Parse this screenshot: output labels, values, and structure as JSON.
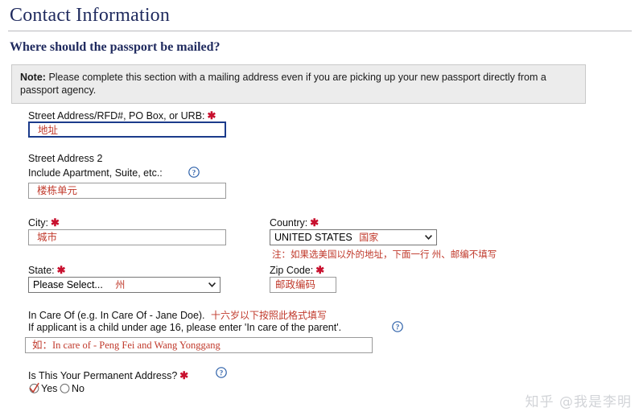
{
  "header": {
    "title": "Contact Information",
    "question": "Where should the passport be mailed?"
  },
  "note": {
    "label": "Note:",
    "text": "Please complete this section with a mailing address even if you are picking up your new passport directly from a passport agency."
  },
  "fields": {
    "street1": {
      "label": "Street Address/RFD#, PO Box, or URB:",
      "required_mark": "✱",
      "value": "地址"
    },
    "street2": {
      "label_line1": "Street Address 2",
      "label_line2": "Include Apartment, Suite, etc.:",
      "help_icon": "help-question-icon",
      "value": "楼栋单元"
    },
    "city": {
      "label": "City:",
      "required_mark": "✱",
      "value": "城市"
    },
    "country": {
      "label": "Country:",
      "required_mark": "✱",
      "value": "UNITED STATES",
      "annotation": "国家",
      "note": "注：如果选美国以外的地址，下面一行 州、邮编不填写",
      "chevron_icon": "chevron-down-icon"
    },
    "state": {
      "label": "State:",
      "required_mark": "✱",
      "value": "Please Select...",
      "annotation": "州",
      "chevron_icon": "chevron-down-icon"
    },
    "zip": {
      "label": "Zip Code:",
      "required_mark": "✱",
      "value": "邮政编码"
    },
    "in_care_of": {
      "label_line1": "In Care Of (e.g. In Care Of - Jane Doe).",
      "annotation": "十六岁以下按照此格式填写",
      "label_line2": "If applicant is a child under age 16, please enter 'In care of the parent'.",
      "help_icon": "help-question-icon",
      "value": "如：In care of - Peng Fei and Wang Yonggang"
    },
    "permanent_address": {
      "label": "Is This Your Permanent Address?",
      "required_mark": "✱",
      "help_icon": "help-question-icon",
      "yes_label": "Yes",
      "no_label": "No",
      "selected": "Yes"
    }
  },
  "watermark": "知乎 @我是李明",
  "colors": {
    "heading": "#1f2a5e",
    "required": "#c8102e",
    "annotation_red": "#c0392b",
    "focus_border": "#1b3b8b",
    "note_bg": "#ececec"
  }
}
